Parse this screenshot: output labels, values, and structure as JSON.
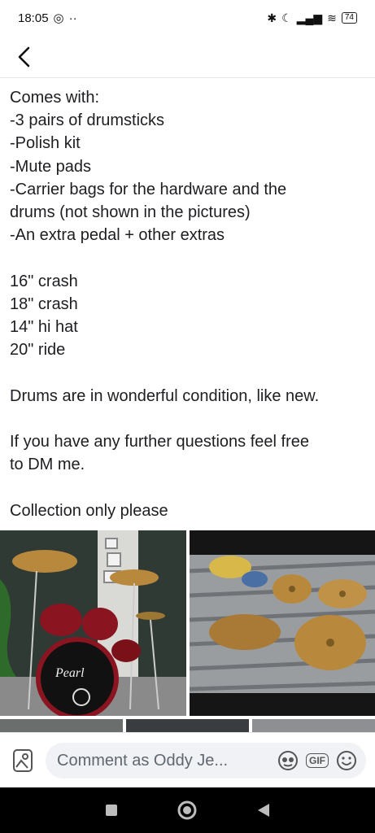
{
  "status": {
    "time": "18:05",
    "battery": "74"
  },
  "nav": {
    "back_label": "Back"
  },
  "post": {
    "lines": [
      "Comes with:",
      "-3 pairs of drumsticks",
      "-Polish kit",
      "-Mute pads",
      "-Carrier bags for the hardware and the",
      "drums (not shown in the pictures)",
      "-An extra pedal + other extras",
      "",
      "16\" crash",
      "18\" crash",
      "14\" hi hat",
      "20\" ride",
      "",
      "Drums are in wonderful condition, like new.",
      "",
      "If you have any further questions feel free",
      "to DM me.",
      "",
      "Collection only please"
    ]
  },
  "photos": {
    "drum_brand": "Pearl"
  },
  "comment": {
    "placeholder": "Comment as Oddy Je...",
    "gif_label": "GIF"
  },
  "colors": {
    "drum_red": "#8a1420",
    "cymbal_gold": "#b8893c",
    "wall_green": "#2f3a35"
  },
  "icons": [
    "back-arrow-icon",
    "photo-icon",
    "avatar-sticker-icon",
    "gif-icon",
    "emoji-icon",
    "square-icon",
    "circle-icon",
    "triangle-icon"
  ]
}
